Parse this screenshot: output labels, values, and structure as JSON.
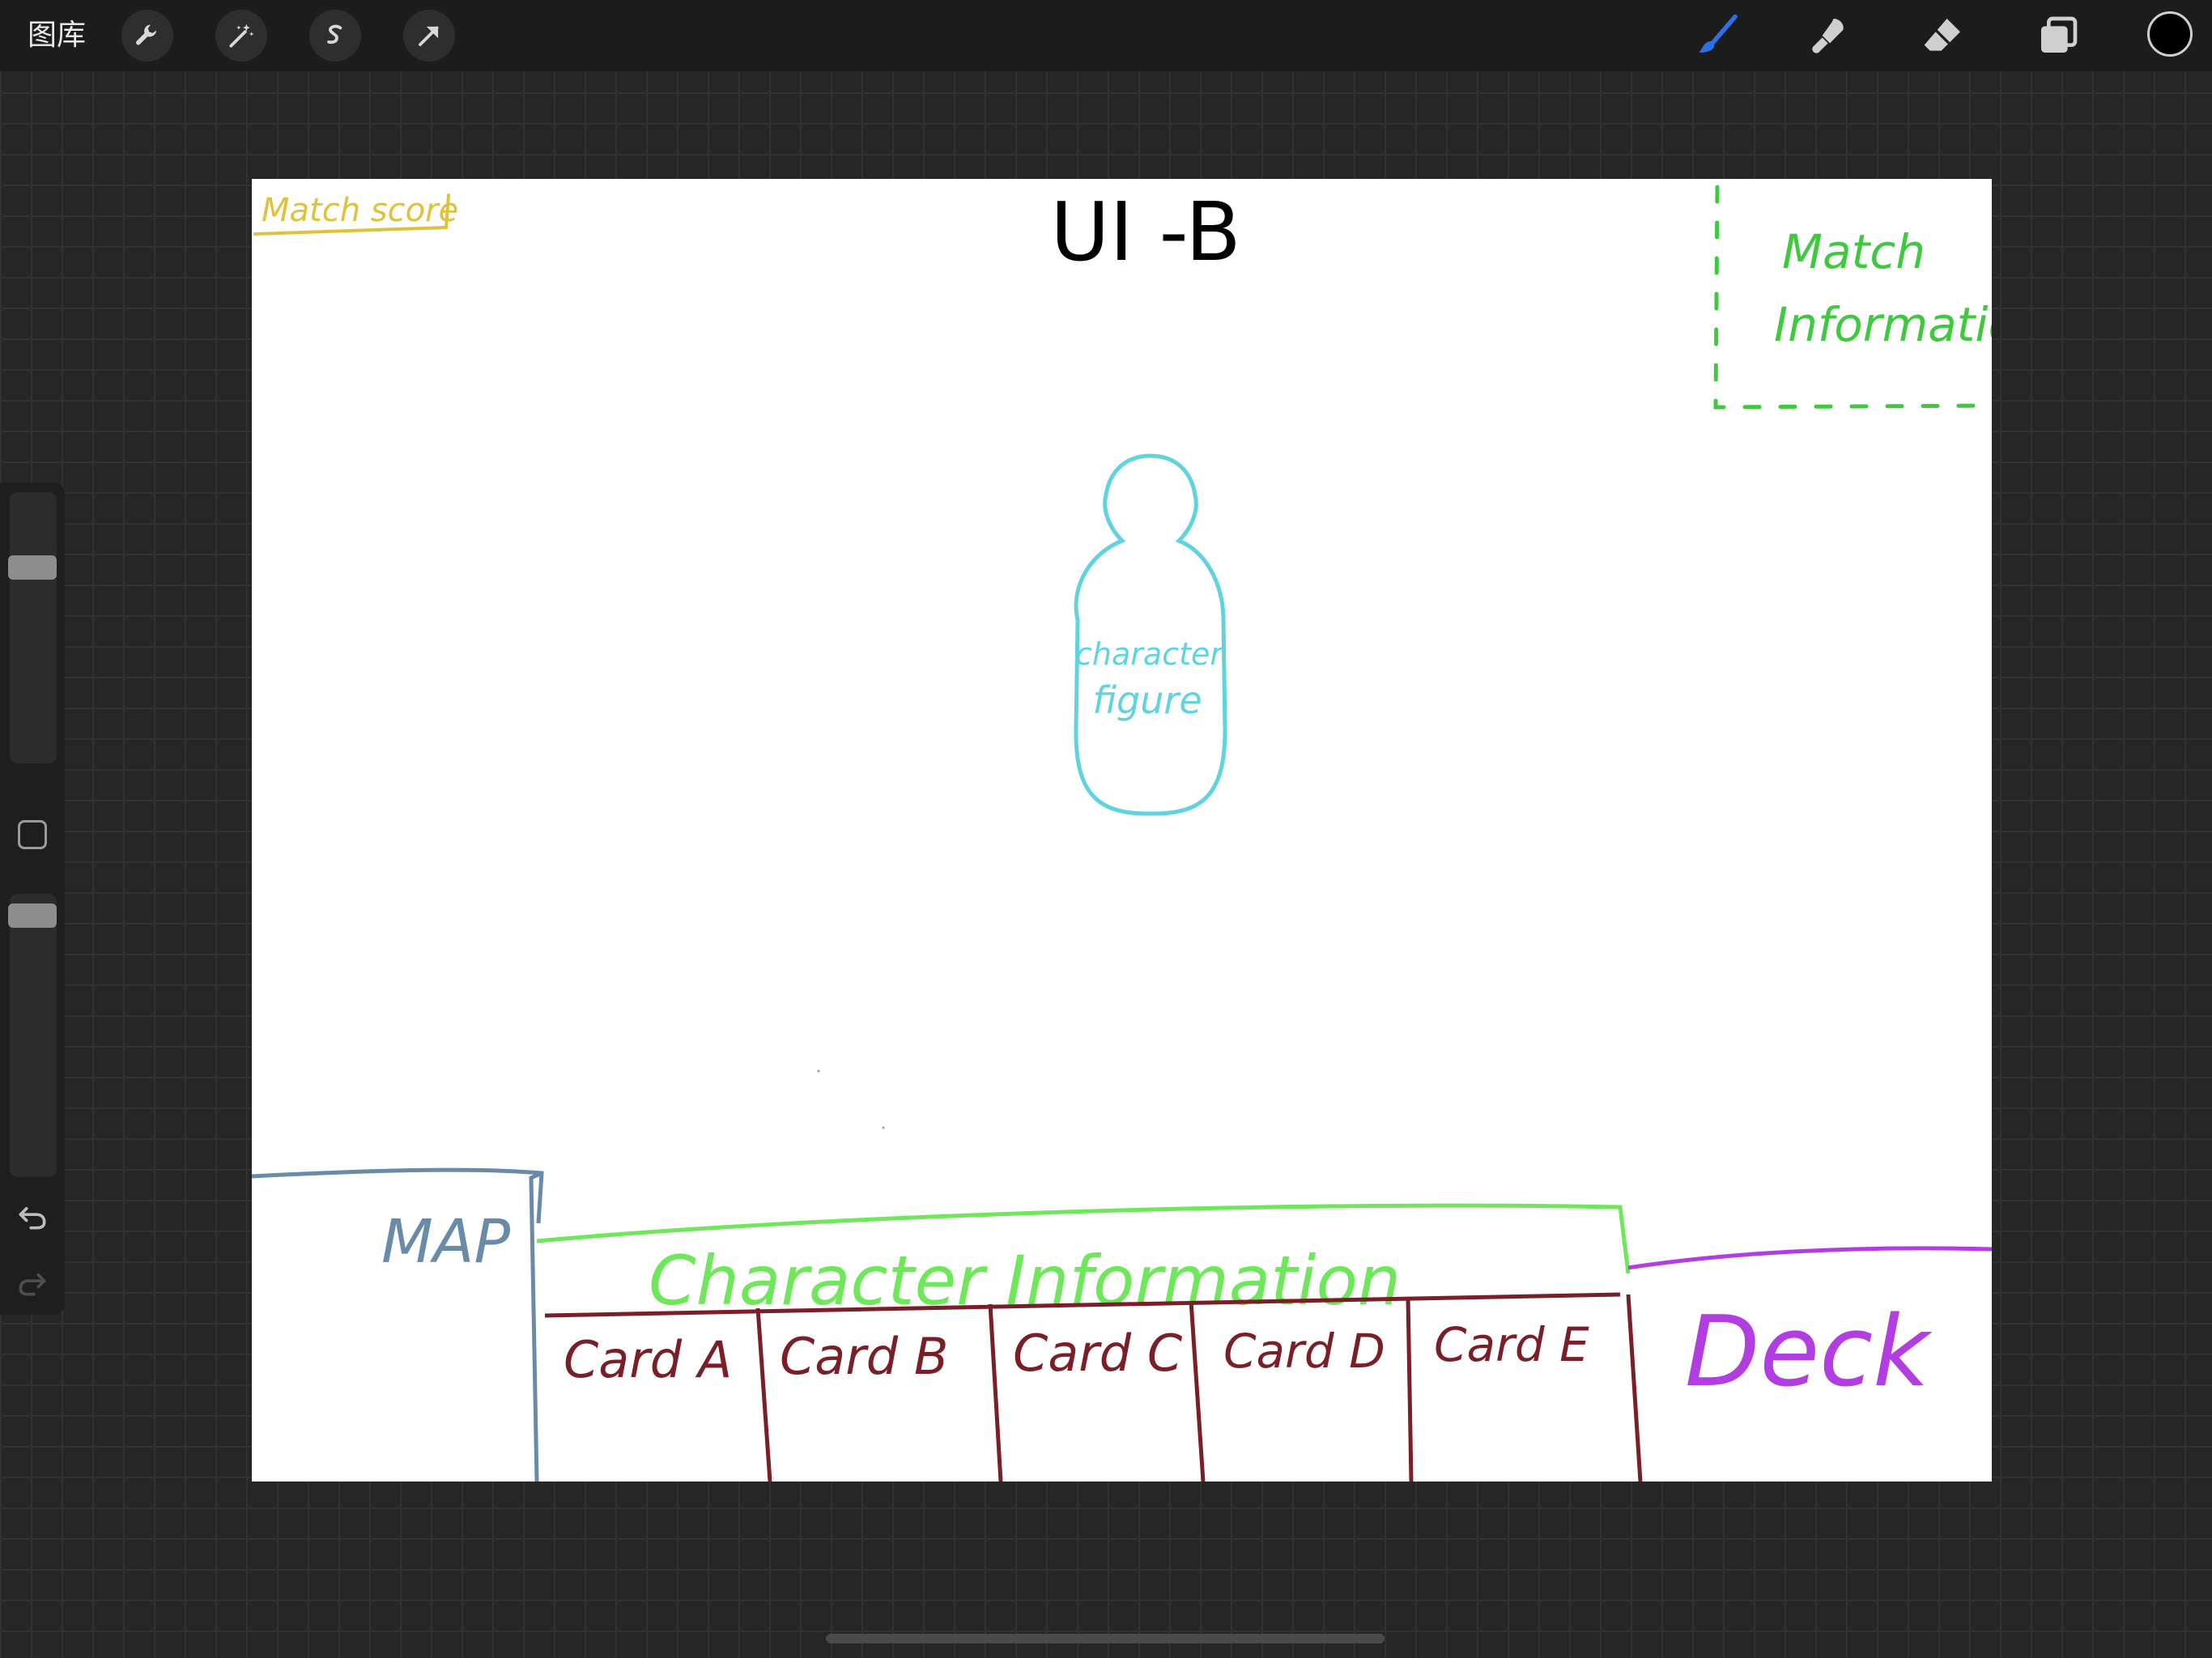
{
  "toolbar": {
    "gallery_label": "图库",
    "left_tools": [
      "wrench-icon",
      "magic-wand-icon",
      "selection-icon",
      "transform-arrow-icon"
    ],
    "right_tools": [
      "brush-icon",
      "smudge-icon",
      "eraser-icon",
      "layers-icon"
    ],
    "active_tool": "brush-icon",
    "active_color": "#000000",
    "brush_color": "#2f6fe6"
  },
  "sidebar": {
    "brush_size_level": 0.2,
    "opacity_level": 0.05,
    "undo_icon": "undo-icon",
    "redo_icon": "redo-icon"
  },
  "sketch": {
    "title": "UI -B",
    "match_score": "Match score",
    "match_information_line1": "Match",
    "match_information_line2": "Information",
    "character_figure_line1": "character",
    "character_figure_line2": "figure",
    "map": "MAP",
    "character_information": "Character Information",
    "cards": [
      "Card A",
      "Card B",
      "Card C",
      "Card D",
      "Card E"
    ],
    "deck": "Deck",
    "colors": {
      "title": "#000000",
      "match_score": "#e0c23a",
      "match_information": "#3fc93f",
      "character": "#5fd3de",
      "map": "#6a8aaa",
      "character_information": "#6ee85a",
      "cards": "#7a1f28",
      "deck": "#b23de0"
    }
  }
}
